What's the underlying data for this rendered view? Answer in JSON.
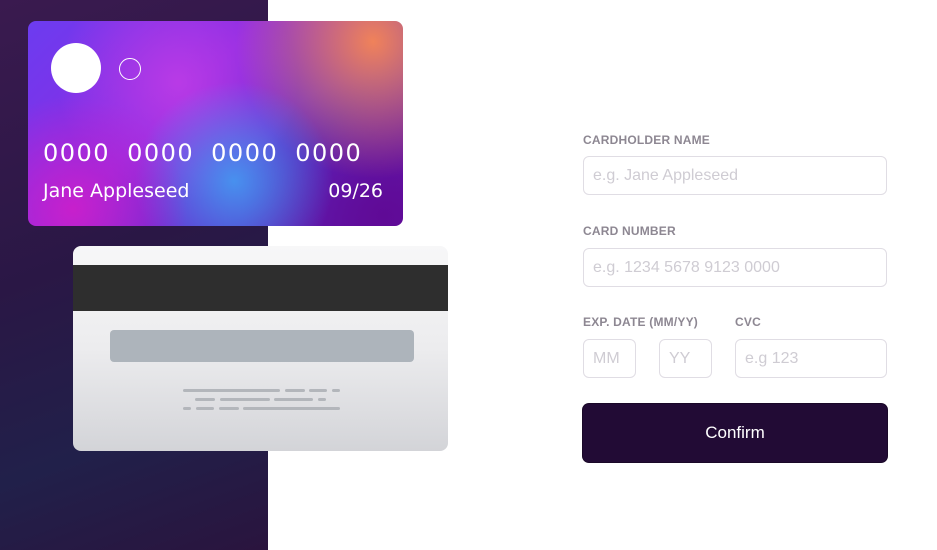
{
  "card_front": {
    "number_groups": [
      "0000",
      "0000",
      "0000",
      "0000"
    ],
    "holder_name": "Jane Appleseed",
    "expiry": "09/26"
  },
  "form": {
    "cardholder_label": "CARDHOLDER NAME",
    "cardholder_placeholder": "e.g. Jane Appleseed",
    "number_label": "CARD NUMBER",
    "number_placeholder": "e.g. 1234 5678 9123 0000",
    "exp_label": "EXP. DATE (MM/YY)",
    "month_placeholder": "MM",
    "year_placeholder": "YY",
    "cvc_label": "CVC",
    "cvc_placeholder": "e.g 123",
    "confirm_label": "Confirm"
  },
  "colors": {
    "side_panel": "#2a1745",
    "button": "#220b35",
    "label": "#8d8792"
  }
}
